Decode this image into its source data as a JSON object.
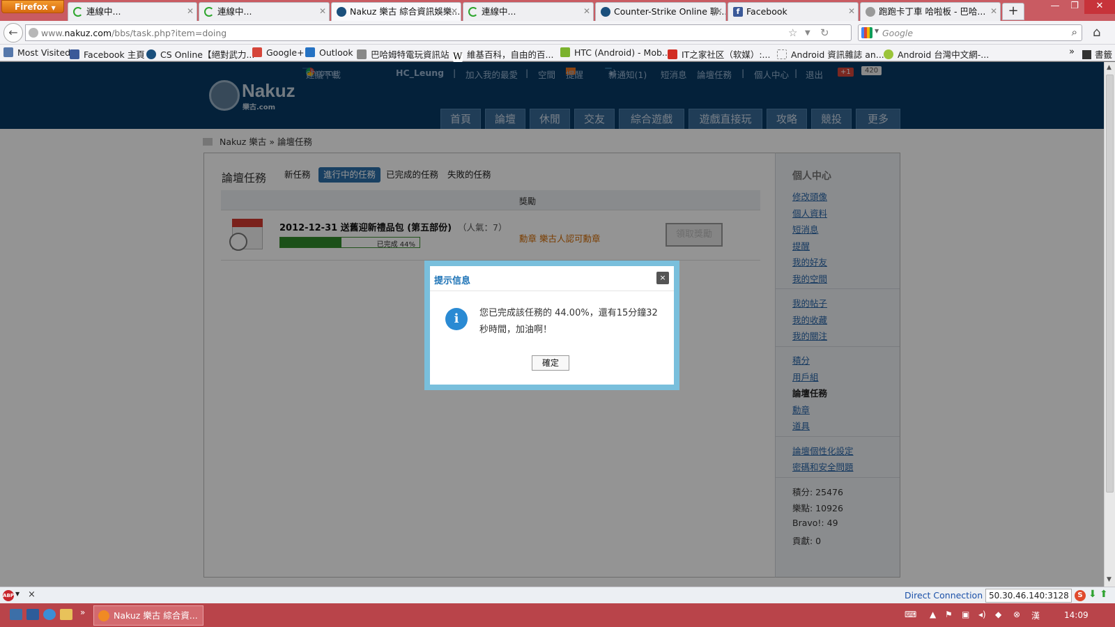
{
  "browser": {
    "menu_label": "Firefox",
    "tabs": [
      {
        "title": "連線中..."
      },
      {
        "title": "連線中..."
      },
      {
        "title": "Nakuz 樂古 綜合資訊娛樂..."
      },
      {
        "title": "連線中..."
      },
      {
        "title": "Counter-Strike Online 聊..."
      },
      {
        "title": "Facebook"
      },
      {
        "title": "跑跑卡丁車 哈啦板 - 巴哈..."
      }
    ],
    "url_prefix": "www.",
    "url_domain": "nakuz.com",
    "url_path": "/bbs/task.php?item=doing",
    "search_placeholder": "Google",
    "bookmarks": [
      {
        "label": "Most Visited"
      },
      {
        "label": "Facebook 主頁"
      },
      {
        "label": "CS Online【絕對武力..."
      },
      {
        "label": "Google+"
      },
      {
        "label": "Outlook"
      },
      {
        "label": "巴哈姆特電玩資訊站"
      },
      {
        "label": "維基百科，自由的百..."
      },
      {
        "label": "HTC (Android) - Mob..."
      },
      {
        "label": "IT之家社区（软媒）:..."
      },
      {
        "label": "Android 資訊雜誌 an..."
      },
      {
        "label": "Android 台灣中文網-..."
      }
    ],
    "bookmarks_more": "»",
    "bookmarks_books": "書籤"
  },
  "site": {
    "topbar": {
      "chrome_download": "建議下載",
      "chrome_label": "chrome",
      "username": "HC_Leung",
      "favorite": "加入我的最愛",
      "space": "空間",
      "remind": "提醒",
      "new_notice": "新通知(1)",
      "short_msg": "短消息",
      "forum_task": "論壇任務",
      "user_center": "個人中心",
      "logout": "退出",
      "gplus": "+1",
      "gplus_count": "420",
      "separator": "|"
    },
    "logo_text": "Nakuz",
    "logo_sub": "樂古.com",
    "nav": [
      "首頁",
      "論壇",
      "休閒",
      "交友",
      "綜合遊戲",
      "遊戲直接玩",
      "攻略",
      "競投",
      "更多"
    ],
    "breadcrumb": {
      "site": "Nakuz 樂古",
      "sep": "»",
      "page": "論壇任務"
    },
    "task_heading": "論壇任務",
    "subtabs": [
      "新任務",
      "進行中的任務",
      "已完成的任務",
      "失敗的任務"
    ],
    "table_header_reward": "獎勵",
    "task": {
      "title": "2012-12-31 送舊迎新禮品包 (第五部份)",
      "popularity": "（人氣：7）",
      "progress_label": "已完成 44%",
      "progress_percent": 44,
      "reward": "勳章 樂古人認可勳章",
      "claim_button": "領取獎勵"
    },
    "sidebar": {
      "title": "個人中心",
      "group1": [
        "修改頭像",
        "個人資料",
        "短消息",
        "提醒",
        "我的好友",
        "我的空間"
      ],
      "group2": [
        "我的帖子",
        "我的收藏",
        "我的關注"
      ],
      "group3": [
        "積分",
        "用戶組",
        "論壇任務",
        "勳章",
        "道具"
      ],
      "group4": [
        "論壇個性化設定",
        "密碼和安全問題"
      ],
      "stats": [
        "積分: 25476",
        "樂點: 10926",
        "Bravo!: 49",
        "貢獻: 0"
      ]
    }
  },
  "dialog": {
    "title": "提示信息",
    "close": "×",
    "icon": "i",
    "message": "您已完成該任務的 44.00%，還有15分鐘32秒時間，加油啊！",
    "ok_button": "確定"
  },
  "statusbar": {
    "abp": "ABP",
    "close": "×",
    "connection": "Direct Connection",
    "proxy": "50.30.46.140:3128",
    "s_icon": "S"
  },
  "taskbar": {
    "more": "»",
    "active_task": "Nakuz 樂古 綜合資...",
    "ime": "漢",
    "time": "14:09"
  },
  "colors": {
    "site_header": "#073a65",
    "dialog_border": "#79bfdc",
    "active_subtab": "#2b6faa",
    "progress": "#2f8a2a",
    "taskbar": "#b9444a",
    "titlebar": "#c95b62"
  }
}
